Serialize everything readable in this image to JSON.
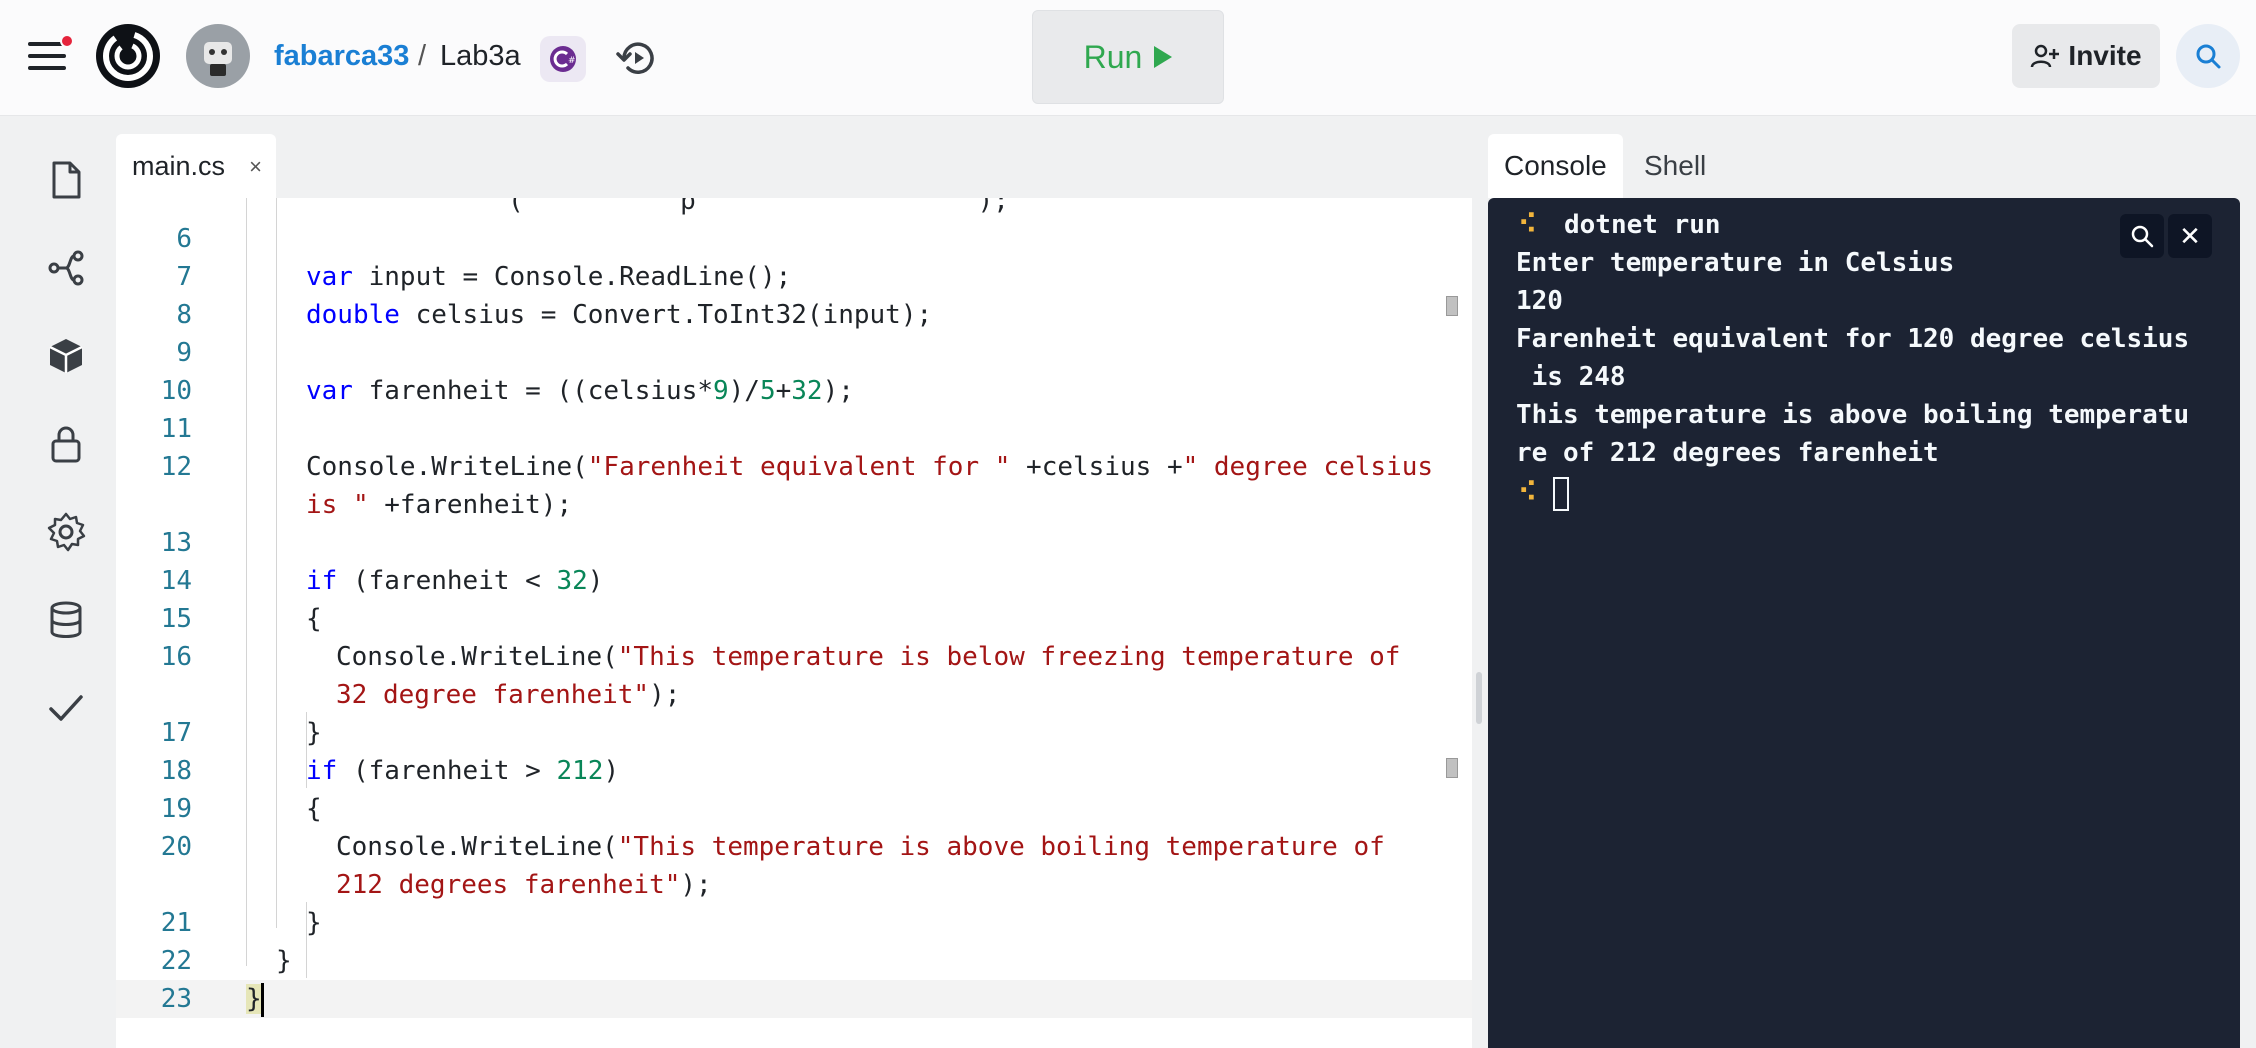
{
  "header": {
    "owner": "fabarca33",
    "separator": "/",
    "repl_name": "Lab3a",
    "run_label": "Run",
    "invite_label": "Invite"
  },
  "sidebar": {
    "items": [
      "files-icon",
      "git-icon",
      "packages-icon",
      "secrets-icon",
      "settings-icon",
      "database-icon",
      "checkmark-icon"
    ]
  },
  "editor": {
    "tab_label": "main.cs",
    "tab_close": "×"
  },
  "console": {
    "tabs": [
      "Console",
      "Shell"
    ],
    "close": "✕",
    "lines": [
      "dotnet run",
      "Enter temperature in Celsius",
      "120",
      "Farenheit equivalent for 120 degree celsius",
      " is 248",
      "This temperature is above boiling temperatu",
      "re of 212 degrees farenheit"
    ]
  },
  "colors": {
    "accent_link": "#1a7fd4",
    "run_green": "#2fa84f",
    "console_bg": "#1c2333",
    "prompt_yellow": "#f2b53c"
  }
}
